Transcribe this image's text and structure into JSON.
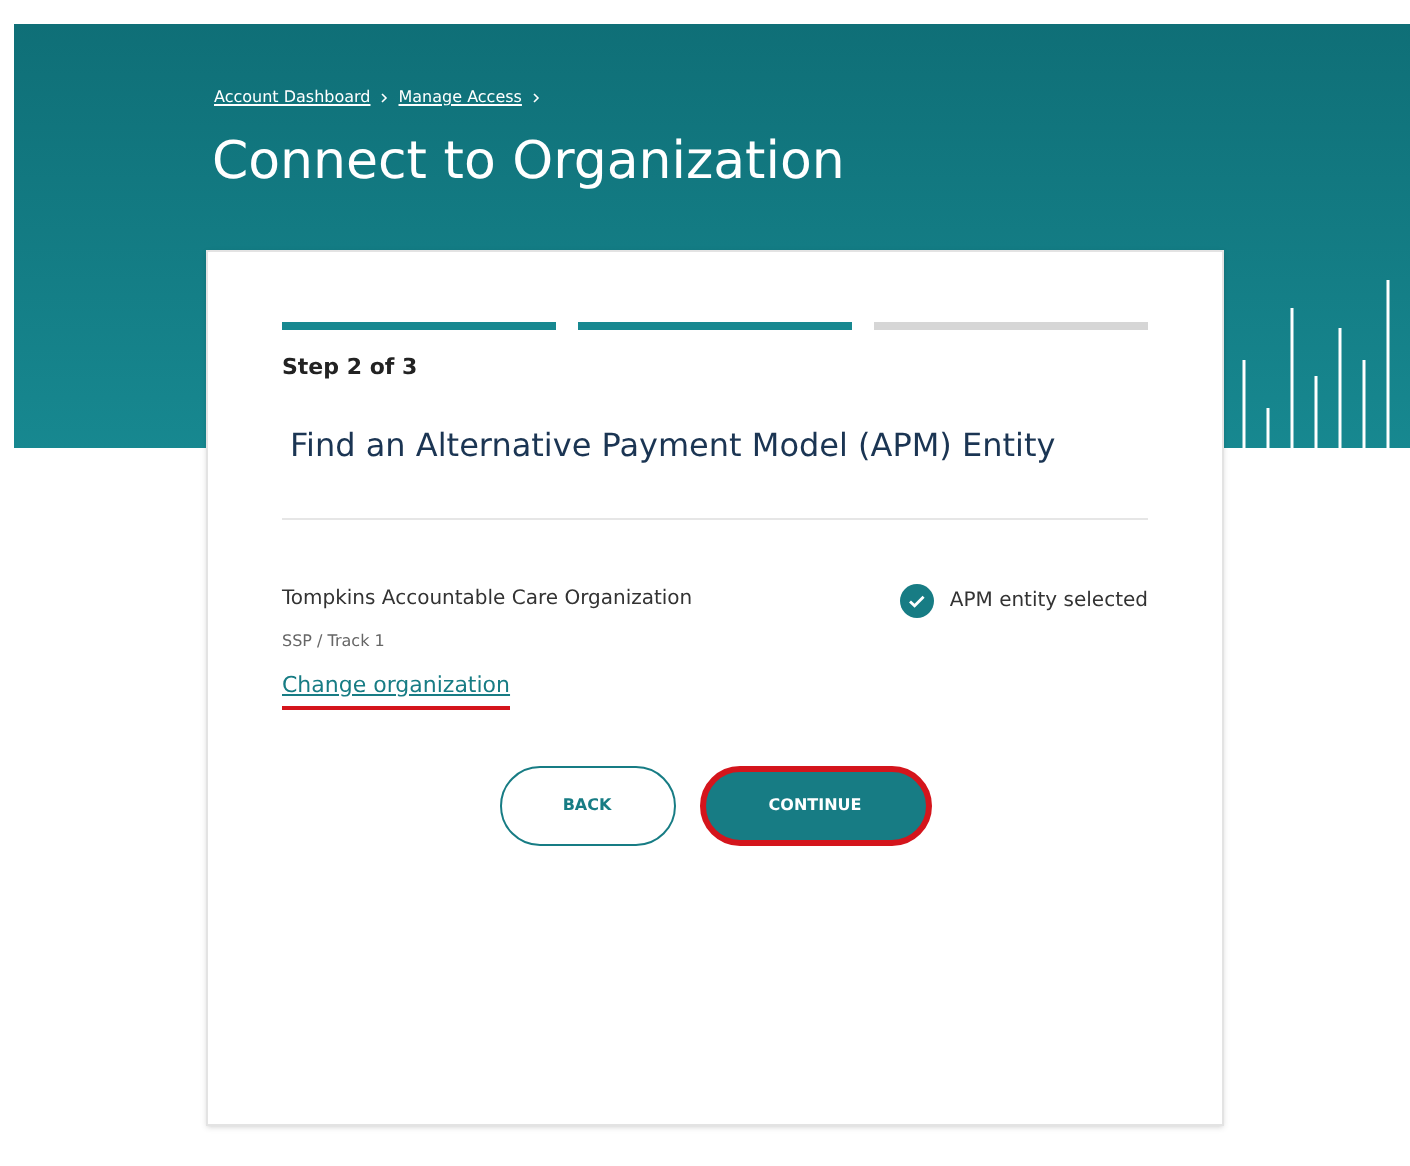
{
  "breadcrumbs": [
    "Account Dashboard",
    "Manage Access"
  ],
  "title": "Connect to Organization",
  "progress": [
    {
      "complete": true
    },
    {
      "complete": true
    },
    {
      "complete": false
    }
  ],
  "step_label": "Step 2 of 3",
  "heading": "Find an Alternative Payment Model (APM) Entity",
  "organization": {
    "name": "Tompkins Accountable Care Organization",
    "detail": "SSP / Track 1",
    "status": "APM entity selected",
    "selected": true
  },
  "change_link": {
    "label": "Change organization",
    "highlighted": true
  },
  "buttons": [
    {
      "label": "BACK",
      "kind": "secondary",
      "highlighted": false
    },
    {
      "label": "CONTINUE",
      "kind": "primary",
      "highlighted": true
    }
  ]
}
